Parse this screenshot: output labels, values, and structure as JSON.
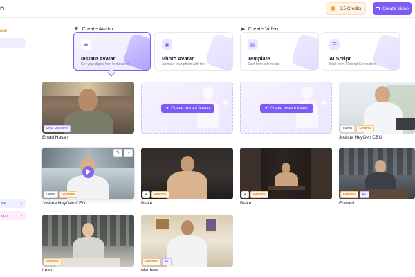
{
  "header": {
    "brand": "n",
    "credits": "8.5 Credits",
    "create_video": "Create Video"
  },
  "sidebar": {
    "partial_text": "atar",
    "items": [
      {
        "label": "ate",
        "arrow": "›"
      },
      {
        "label": "sion",
        "arrow": "›"
      }
    ]
  },
  "sections": {
    "create_avatar": "Create Avatar",
    "create_video": "Create Video"
  },
  "cards": [
    {
      "title": "Instant Avatar",
      "subtitle": "Get your digital twin in minutes!",
      "icon": "person-plus-icon",
      "selected": true
    },
    {
      "title": "Photo Avatar",
      "subtitle": "Animate your photo with text",
      "icon": "photo-icon",
      "selected": false
    },
    {
      "title": "Template",
      "subtitle": "Start from a template",
      "icon": "template-icon",
      "selected": false
    },
    {
      "title": "AI Script",
      "subtitle": "Start from AI script Generation",
      "icon": "script-icon",
      "selected": false
    }
  ],
  "placeholder_button": "Create Instant Avatar",
  "tiles": [
    {
      "name": "Emad Hasan",
      "badges": [
        "Free Revision"
      ]
    },
    {
      "name": "Joshua HeyGen CEO",
      "badges": [
        "Demo",
        "Firstime"
      ]
    },
    {
      "name": "Joshua HeyGen CEO",
      "badges": [
        "Demo",
        "Firstime"
      ]
    },
    {
      "name": "Blake",
      "badges": [
        "4",
        "Firstime"
      ]
    },
    {
      "name": "Blake",
      "badges": [
        "4",
        "Firstime"
      ]
    },
    {
      "name": "Edward",
      "badges": [
        "Firstime",
        "4K"
      ]
    },
    {
      "name": "Leah",
      "badges": [
        "Firstime"
      ]
    },
    {
      "name": "Matthew",
      "badges": [
        "Firstime",
        "4K"
      ]
    }
  ],
  "colors": {
    "accent": "#7c5cf5",
    "firstime": "#b86a00",
    "credits_bg": "#fff3e6"
  }
}
